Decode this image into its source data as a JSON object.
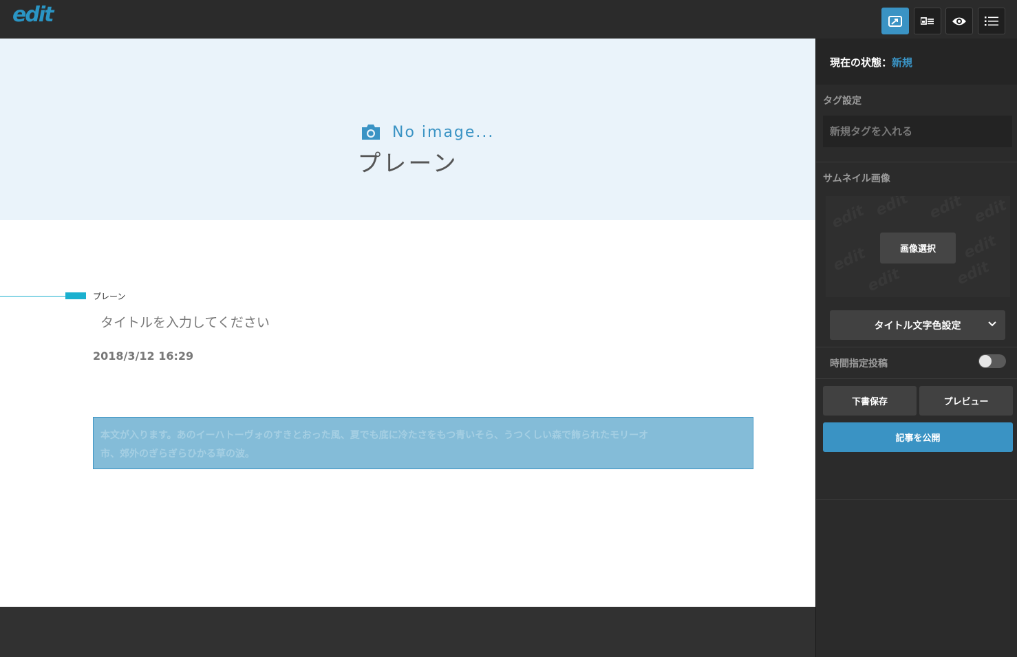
{
  "header": {
    "logo": "edit",
    "buttons": [
      {
        "name": "share-icon",
        "active": true
      },
      {
        "name": "card-list-icon",
        "active": false
      },
      {
        "name": "eye-icon",
        "active": false
      },
      {
        "name": "list-icon",
        "active": false
      }
    ]
  },
  "hero": {
    "icon": "camera-icon",
    "no_image_text": "No image...",
    "category": "プレーン"
  },
  "article": {
    "category_label": "プレーン",
    "title_placeholder": "タイトルを入力してください",
    "date": "2018/3/12 16:29",
    "body_line_1": "本文が入ります。あのイーハトーヴォのすきとおった風、夏でも底に冷たさをもつ青いそら、うつくしい森で飾られたモリーオ",
    "body_line_2": "市、郊外のぎらぎらひかる草の波。"
  },
  "sidebar": {
    "status_label": "現在の状態：",
    "status_value": "新規",
    "tag_section_label": "タグ設定",
    "tag_input_placeholder": "新規タグを入れる",
    "thumbnail_label": "サムネイル画像",
    "select_image_button": "画像選択",
    "title_color_select": "タイトル文字色設定",
    "schedule_label": "時間指定投稿",
    "schedule_enabled": false,
    "save_draft_button": "下書保存",
    "preview_button": "プレビュー",
    "publish_button": "記事を公開"
  },
  "colors": {
    "accent": "#3a93c4",
    "line_accent": "#1ab0cf",
    "dark_bg": "#2b2b2b",
    "hero_bg": "#eaf3fa"
  }
}
